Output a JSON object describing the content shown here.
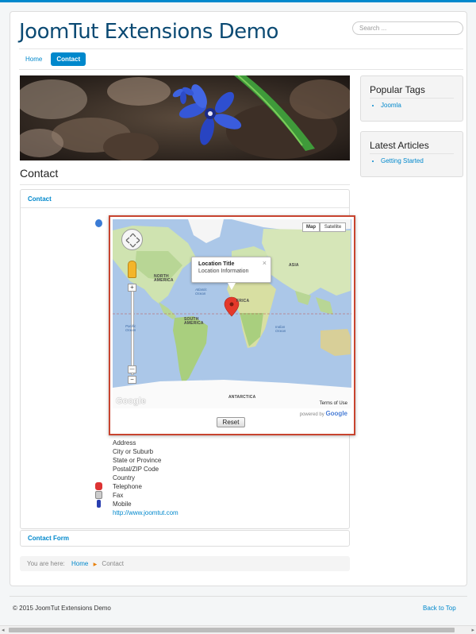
{
  "site": {
    "title": "JoomTut Extensions Demo",
    "search_placeholder": "Search ..."
  },
  "nav": {
    "items": [
      {
        "label": "Home",
        "active": false
      },
      {
        "label": "Contact",
        "active": true
      }
    ]
  },
  "page": {
    "heading": "Contact"
  },
  "contact_panel": {
    "title": "Contact"
  },
  "map": {
    "types": {
      "map": "Map",
      "satellite": "Satellite"
    },
    "info_title": "Location Title",
    "info_desc": "Location Information",
    "close": "×",
    "labels": {
      "north_america": "NORTH\nAMERICA",
      "south_america": "SOUTH\nAMERICA",
      "asia": "ASIA",
      "africa": "FRICA",
      "antarctica": "ANTARCTICA",
      "atlantic": "Atlantic\nOcean",
      "pacific": "Pacific\nOcean",
      "indian": "Indian\nOcean"
    },
    "google": "Google",
    "terms": "Terms of Use",
    "powered_by": "powered by",
    "powered_brand": "Google",
    "zoom_in": "+",
    "zoom_out": "−",
    "reset": "Reset"
  },
  "address": {
    "street": "Address",
    "city": "City or Suburb",
    "state": "State or Province",
    "postcode": "Postal/ZIP Code",
    "country": "Country",
    "telephone": "Telephone",
    "fax": "Fax",
    "mobile": "Mobile",
    "website": "http://www.joomtut.com"
  },
  "form_panel": {
    "title": "Contact Form"
  },
  "breadcrumb": {
    "prefix": "You are here:",
    "home": "Home",
    "current": "Contact"
  },
  "sidebar": {
    "popular_tags": {
      "title": "Popular Tags",
      "items": [
        "Joomla"
      ]
    },
    "latest_articles": {
      "title": "Latest Articles",
      "items": [
        "Getting Started"
      ]
    }
  },
  "footer": {
    "copyright": "© 2015 JoomTut Extensions Demo",
    "back_to_top": "Back to Top"
  },
  "colors": {
    "accent": "#0088cc",
    "title": "#0b4a73",
    "map_border": "#c8442f",
    "marker": "#e4392b"
  }
}
